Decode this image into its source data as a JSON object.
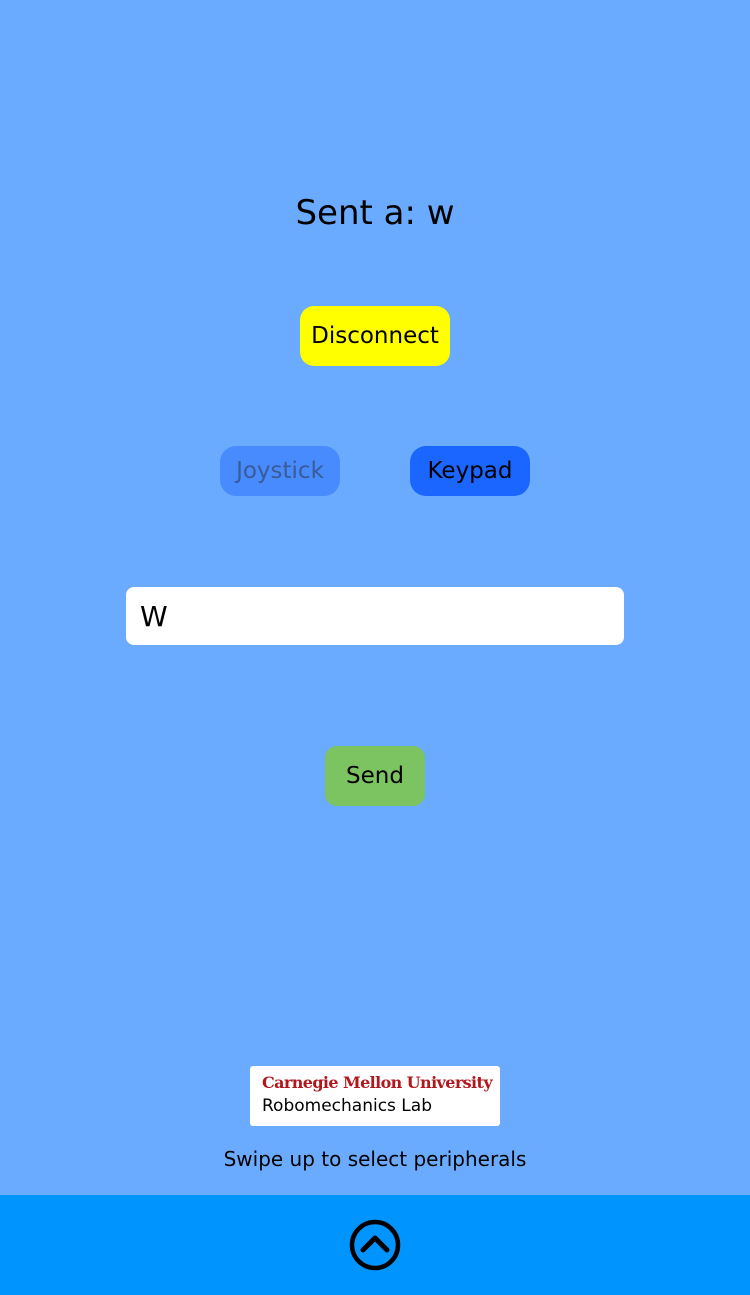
{
  "status": {
    "text": "Sent a: w"
  },
  "buttons": {
    "disconnect": "Disconnect",
    "joystick": "Joystick",
    "keypad": "Keypad",
    "send": "Send"
  },
  "input": {
    "value": "W"
  },
  "logo": {
    "university": "Carnegie Mellon University",
    "lab": "Robomechanics Lab"
  },
  "hint": {
    "text": "Swipe up to select peripherals"
  },
  "bottom_bar": {
    "icon": "chevron-up-circle-icon"
  },
  "colors": {
    "background": "#6aabff",
    "disconnect": "#ffff00",
    "joystick": "#478bff",
    "keypad": "#1a66ff",
    "send": "#7cc461",
    "bottom_bar": "#0094ff",
    "logo_red": "#b1181e"
  }
}
